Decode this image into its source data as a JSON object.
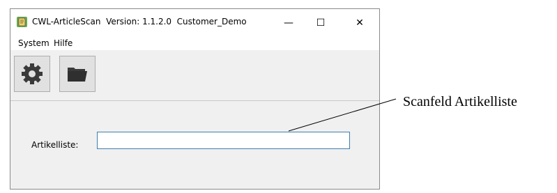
{
  "window": {
    "title": "CWL-ArticleScan  Version: 1.1.2.0  Customer_Demo",
    "minimize_glyph": "—",
    "maximize_glyph": "☐",
    "close_glyph": "✕"
  },
  "menu": {
    "items": [
      {
        "label": "System"
      },
      {
        "label": "Hilfe"
      }
    ]
  },
  "toolbar": {
    "buttons": [
      {
        "icon": "gear-icon"
      },
      {
        "icon": "folder-icon"
      }
    ]
  },
  "form": {
    "label": "Artikelliste:",
    "input_value": ""
  },
  "annotation": {
    "text": "Scanfeld Artikelliste"
  },
  "colors": {
    "window_bg": "#f0f0f0",
    "titlebar_bg": "#ffffff",
    "input_border": "#3c7fb1",
    "icon_dark": "#3a3a3a"
  }
}
